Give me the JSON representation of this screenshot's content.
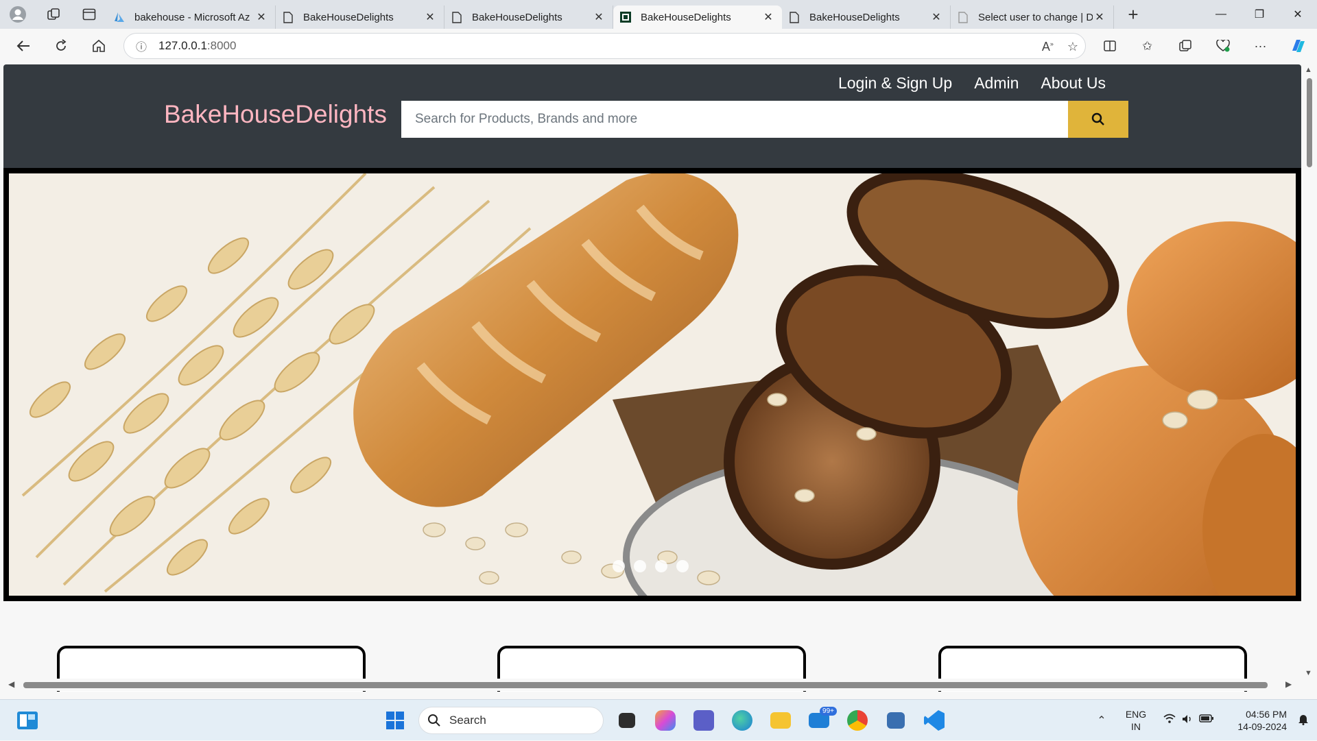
{
  "browser": {
    "tabs": [
      {
        "title": "bakehouse - Microsoft Az",
        "active": false,
        "favicon": "azure-icon"
      },
      {
        "title": "BakeHouseDelights",
        "active": false,
        "favicon": "page-icon"
      },
      {
        "title": "BakeHouseDelights",
        "active": false,
        "favicon": "page-icon"
      },
      {
        "title": "BakeHouseDelights",
        "active": true,
        "favicon": "django-icon"
      },
      {
        "title": "BakeHouseDelights",
        "active": false,
        "favicon": "page-icon"
      },
      {
        "title": "Select user to change | Dj",
        "active": false,
        "favicon": "page-icon"
      }
    ],
    "url_host": "127.0.0.1",
    "url_port": ":8000"
  },
  "site": {
    "brand": "BakeHouseDelights",
    "menu": [
      "Login & Sign Up",
      "Admin",
      "About Us"
    ],
    "search_placeholder": "Search for Products, Brands and more",
    "carousel_slides": 4,
    "accent_color": "#e0b43a",
    "brand_color": "#ffb6c1",
    "header_color": "#343a40"
  },
  "taskbar": {
    "search_label": "Search",
    "mail_badge": "99+",
    "lang_line1": "ENG",
    "lang_line2": "IN",
    "time": "04:56 PM",
    "date": "14-09-2024"
  }
}
